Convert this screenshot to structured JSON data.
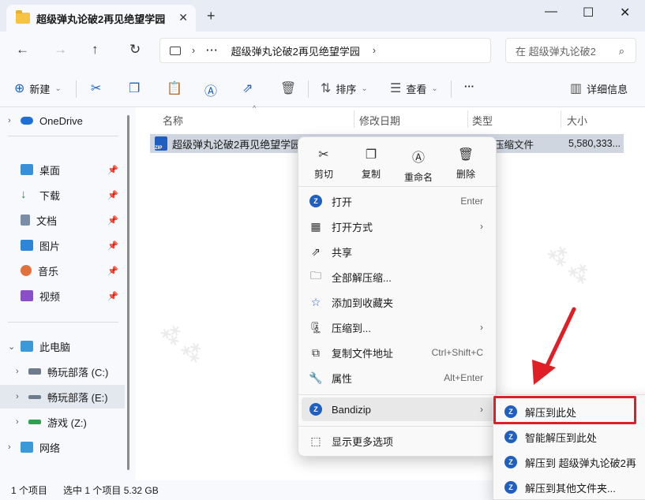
{
  "window": {
    "tab_title": "超级弹丸论破2再见绝望学园",
    "tab_close": "✕",
    "tab_add": "+",
    "controls": [
      "—",
      "☐",
      "✕"
    ]
  },
  "nav": {
    "back": "←",
    "forward": "→",
    "up": "↑",
    "refresh": "↻",
    "address_sep": "›",
    "address_dots": "···",
    "address_path": "超级弹丸论破2再见绝望学园",
    "search_placeholder": "在 超级弹丸论破2"
  },
  "toolbar": {
    "new_label": "新建",
    "sort_label": "排序",
    "view_label": "查看",
    "more_label": "···",
    "details_label": "详细信息"
  },
  "sidebar": {
    "onedrive": "OneDrive",
    "quick": [
      {
        "label": "桌面",
        "icon": "desktop-icon"
      },
      {
        "label": "下载",
        "icon": "download-icon"
      },
      {
        "label": "文档",
        "icon": "document-icon"
      },
      {
        "label": "图片",
        "icon": "picture-icon"
      },
      {
        "label": "音乐",
        "icon": "music-icon"
      },
      {
        "label": "视频",
        "icon": "video-icon"
      }
    ],
    "this_pc": "此电脑",
    "drives": [
      {
        "label": "畅玩部落 (C:)"
      },
      {
        "label": "畅玩部落 (E:)"
      },
      {
        "label": "游戏 (Z:)"
      }
    ],
    "network": "网络"
  },
  "columns": {
    "name": "名称",
    "modified": "修改日期",
    "type": "类型",
    "size": "大小"
  },
  "file": {
    "name": "超级弹丸论破2再见绝望学园",
    "type": "压缩文件",
    "size": "5,580,333..."
  },
  "status": {
    "count": "1 个项目",
    "selected": "选中 1 个项目  5.32 GB"
  },
  "context_menu": {
    "quick": {
      "cut": "剪切",
      "copy": "复制",
      "rename": "重命名",
      "delete": "删除"
    },
    "items": {
      "open": "打开",
      "open_shortcut": "Enter",
      "open_with": "打开方式",
      "share": "共享",
      "extract_all": "全部解压缩...",
      "favorite": "添加到收藏夹",
      "compress": "压缩到...",
      "copy_path": "复制文件地址",
      "copy_path_shortcut": "Ctrl+Shift+C",
      "properties": "属性",
      "properties_shortcut": "Alt+Enter",
      "bandizip": "Bandizip",
      "more_options": "显示更多选项"
    }
  },
  "submenu": {
    "extract_here": "解压到此处",
    "smart_extract": "智能解压到此处",
    "extract_to": "解压到 超级弹丸论破2再",
    "extract_other": "解压到其他文件夹..."
  },
  "colors": {
    "accent": "#1f5fbf",
    "highlight_box": "#e01e26",
    "arrow": "#e01e26"
  }
}
